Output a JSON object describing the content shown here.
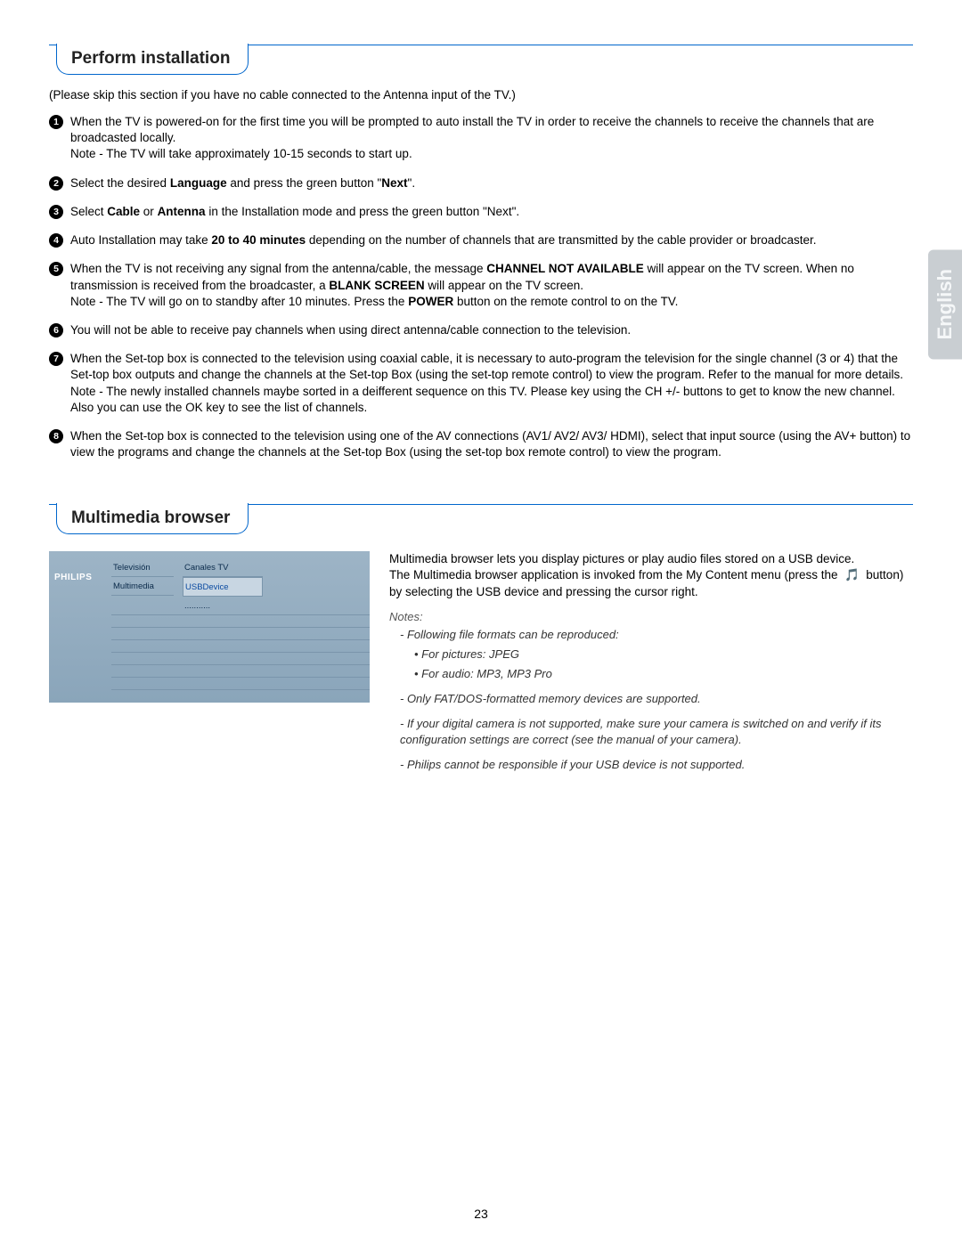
{
  "lang_tab": "English",
  "page_number": "23",
  "section1": {
    "heading": "Perform installation",
    "skip_note": "(Please skip this section if you have no cable connected to the Antenna input of the TV.)",
    "steps": [
      {
        "n": "1",
        "html": "When the TV is powered-on for the first time you will be prompted to auto install the TV in order to receive the channels to receive the channels that are broadcasted locally.<br>Note - The TV will take approximately 10-15 seconds to start up."
      },
      {
        "n": "2",
        "html": "Select the desired <b>Language</b> and press the green button \"<b>Next</b>\"."
      },
      {
        "n": "3",
        "html": "Select <b>Cable</b> or <b>Antenna</b> in the Installation mode and press the green button \"Next\"."
      },
      {
        "n": "4",
        "html": "Auto Installation may take <b>20 to 40 minutes</b> depending on the number of channels that are transmitted by the cable provider or broadcaster."
      },
      {
        "n": "5",
        "html": "When the TV is not receiving any signal from the antenna/cable, the message <b>CHANNEL NOT AVAILABLE</b> will appear on the TV screen. When no transmission is received from the broadcaster, a <b>BLANK SCREEN</b> will appear on the TV screen.<br>Note - The TV will go on to standby after 10 minutes. Press the <b>POWER</b> button on the remote control to on the TV."
      },
      {
        "n": "6",
        "html": "You will not be able to receive pay channels when using direct antenna/cable connection to the television."
      },
      {
        "n": "7",
        "html": "When the Set-top box is connected to the television using coaxial cable, it is necessary to auto-program the television for the single channel (3 or 4) that the Set-top box outputs and change the channels at the Set-top Box (using the set-top remote control) to view the program. Refer to the manual for more details.<br>Note - The newly installed channels maybe sorted in a deifferent sequence on this TV. Please key using the CH +/- buttons to get to know the new channel. Also you can use the OK key to see the list of channels."
      },
      {
        "n": "8",
        "html": "When the Set-top box is connected to the television using one of the AV connections (AV1/ AV2/ AV3/ HDMI), select that input source (using the AV+ button) to view the programs and change the channels at the Set-top Box (using the set-top box remote control) to view the program."
      }
    ]
  },
  "section2": {
    "heading": "Multimedia browser",
    "screenshot": {
      "logo": "PHILIPS",
      "col1_row1": "Televisión",
      "col1_row2": "Multimedia",
      "col2_row1": "Canales TV",
      "col2_row2": "USBDevice",
      "col2_row3": "..........."
    },
    "intro_html": "Multimedia browser lets you display pictures or play audio files stored on a USB device.<br>The Multimedia browser application is invoked from the My Content menu (press the &nbsp;🎵&nbsp; button) by selecting the USB device and pressing the cursor right.",
    "notes_label": "Notes:",
    "notes": [
      "- Following file formats can be reproduced:",
      "• For pictures: JPEG",
      "• For audio: MP3, MP3 Pro",
      "- Only FAT/DOS-formatted memory devices are supported.",
      "- If your digital camera is not supported, make sure your camera is switched on and verify if its configuration settings are correct (see the manual of your camera).",
      "- Philips cannot be responsible if your USB device is not supported."
    ]
  }
}
